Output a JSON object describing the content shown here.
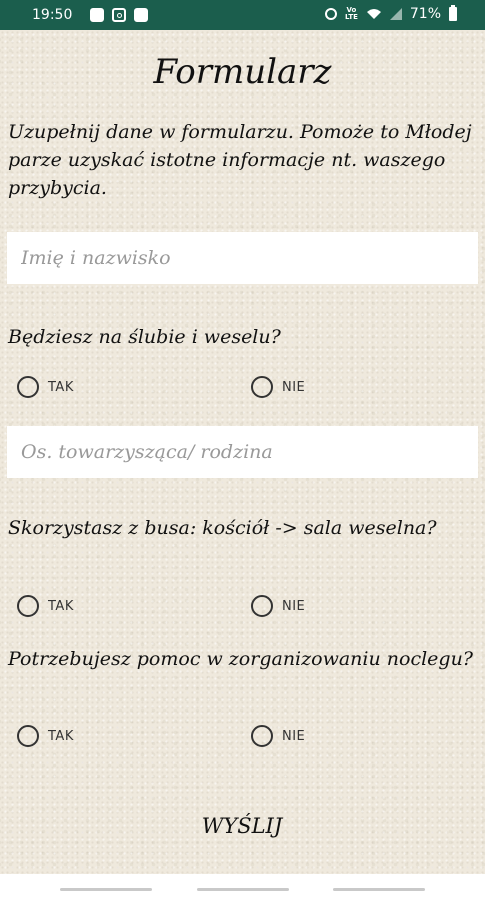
{
  "status_bar": {
    "time": "19:50",
    "battery": "71%"
  },
  "form": {
    "title": "Formularz",
    "description": "Uzupełnij dane w formularzu. Pomoże to Młodej parze uzyskać istotne informacje nt. waszego przybycia.",
    "name_placeholder": "Imię i nazwisko",
    "companion_placeholder": "Os. towarzysząca/ rodzina",
    "questions": [
      {
        "text": "Będziesz na ślubie i weselu?",
        "options": [
          "TAK",
          "NIE"
        ]
      },
      {
        "text": "Skorzystasz z busa: kościół -> sala weselna?",
        "options": [
          "TAK",
          "NIE"
        ]
      },
      {
        "text": "Potrzebujesz pomoc w zorganizowaniu noclegu?",
        "options": [
          "TAK",
          "NIE"
        ]
      }
    ],
    "submit_label": "WYŚLIJ"
  }
}
